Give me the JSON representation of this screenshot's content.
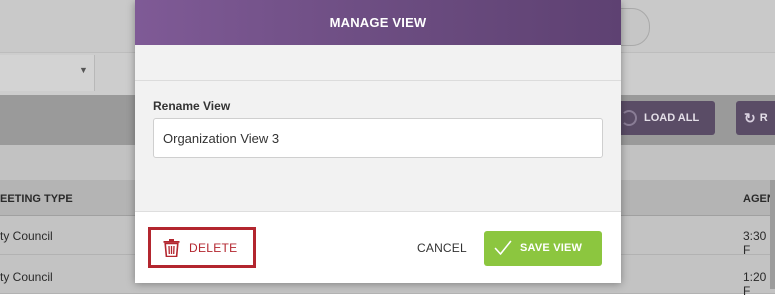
{
  "modal": {
    "title": "MANAGE VIEW",
    "rename_label": "Rename View",
    "rename_value": "Organization View 3",
    "delete_label": "DELETE",
    "cancel_label": "CANCEL",
    "save_label": "SAVE VIEW",
    "accent_color": "#6b4c80",
    "save_color": "#8cc63f",
    "delete_color": "#b3262f"
  },
  "background": {
    "load_all_label": "LOAD ALL",
    "refresh_label": "R",
    "columns": [
      "EETING TYPE",
      "AGEN"
    ],
    "rows": [
      {
        "type": "ty Council",
        "time": "3:30 F"
      },
      {
        "type": "ty Council",
        "time": "1:20 F"
      }
    ]
  },
  "icons": {
    "delete": "trash-icon",
    "save": "checkmark-icon",
    "load_all": "refresh-icon",
    "refresh": "refresh-icon",
    "dropdown": "chevron-down-icon"
  }
}
